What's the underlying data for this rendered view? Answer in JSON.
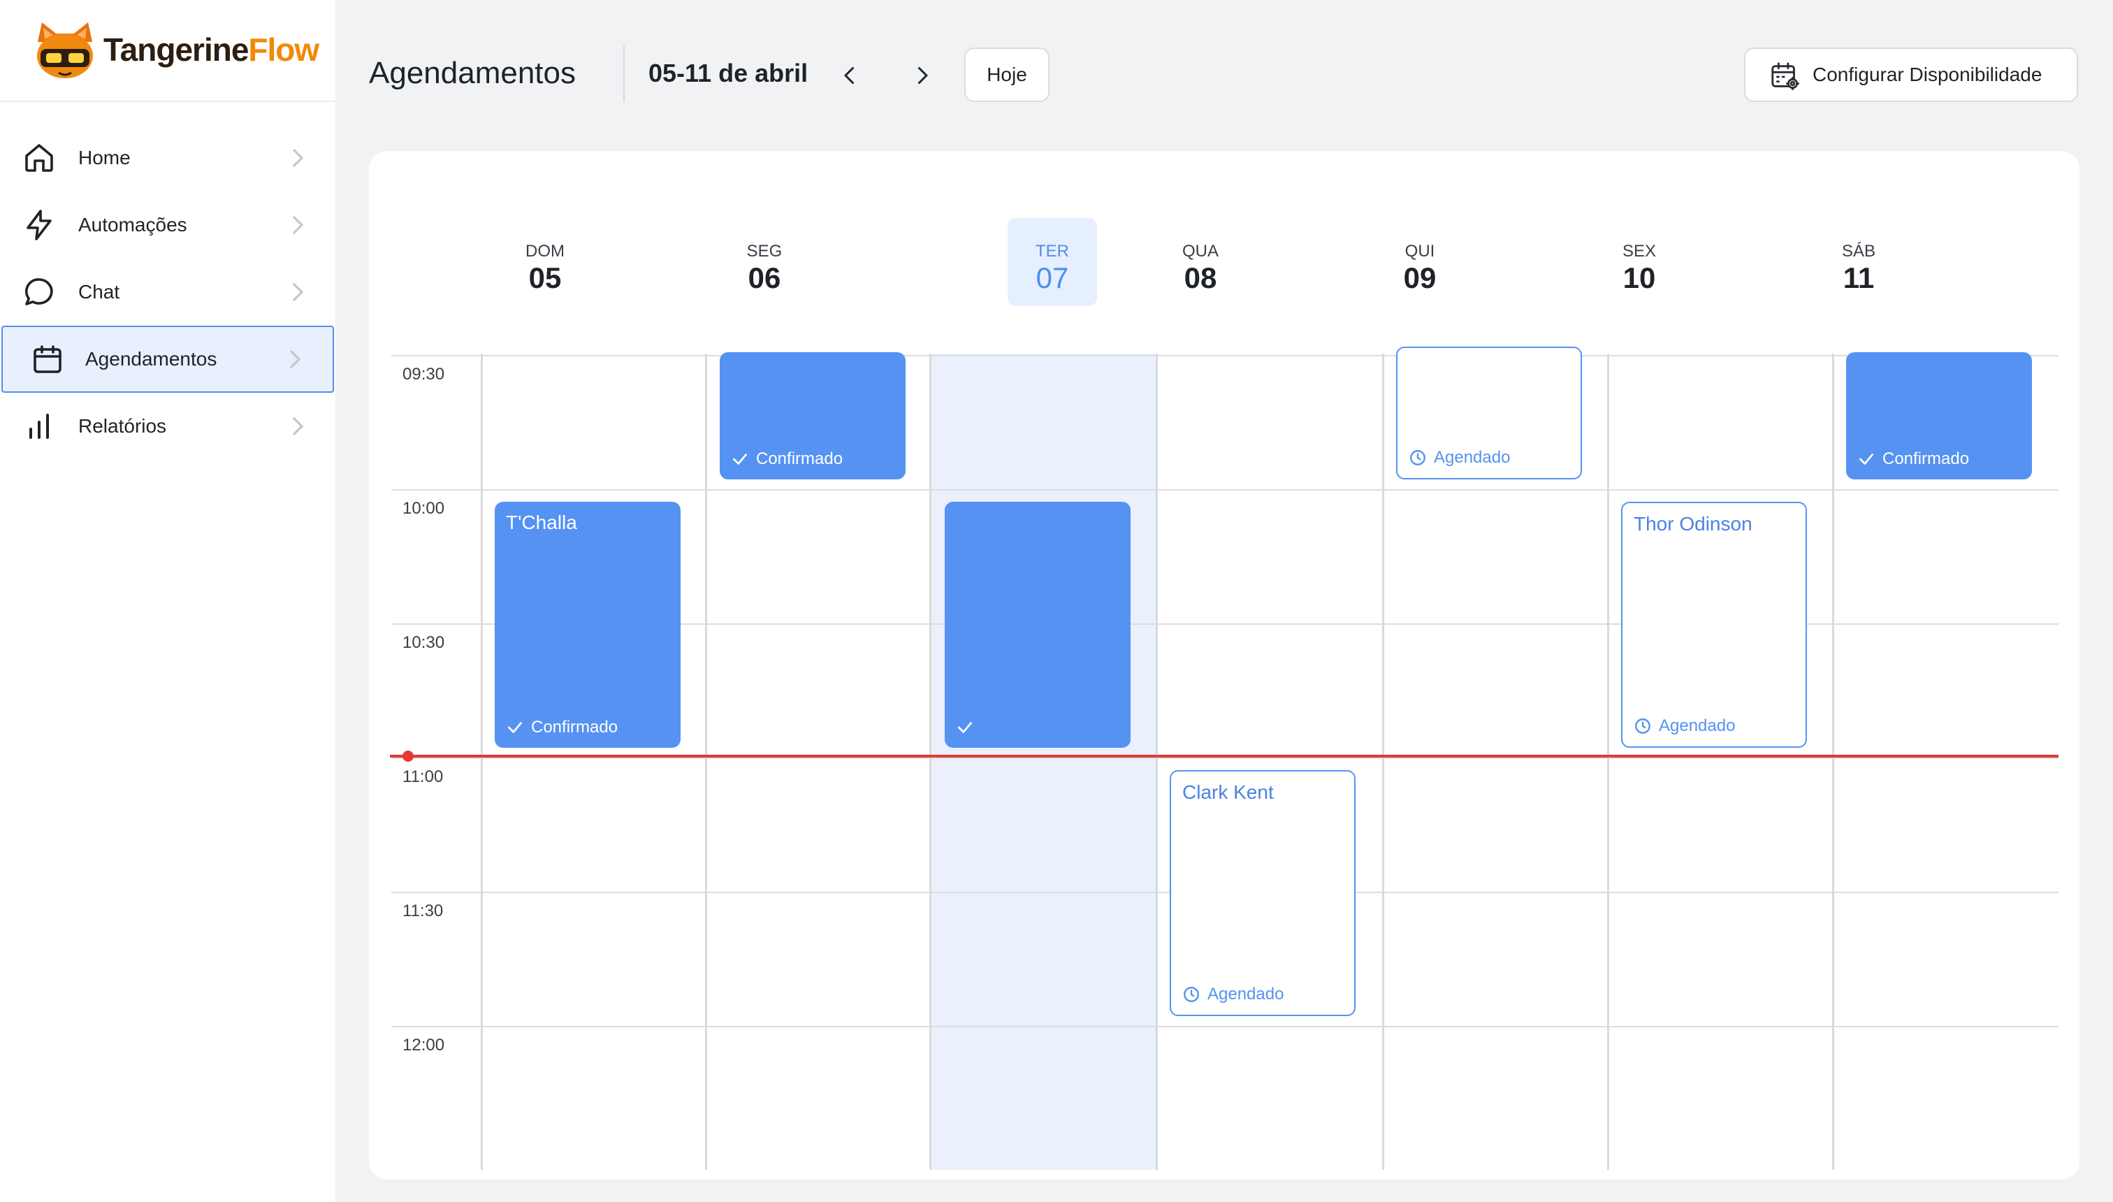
{
  "app": {
    "logo_part1": "Tangerine",
    "logo_part2": "Flow"
  },
  "sidebar": {
    "items": [
      {
        "label": "Home",
        "icon": "home-icon"
      },
      {
        "label": "Automações",
        "icon": "lightning-icon"
      },
      {
        "label": "Chat",
        "icon": "chat-bubble-icon"
      },
      {
        "label": "Agendamentos",
        "icon": "calendar-icon",
        "active": true
      },
      {
        "label": "Relatórios",
        "icon": "bar-chart-icon"
      }
    ]
  },
  "header": {
    "title": "Agendamentos",
    "date_range": "05-11 de abril",
    "today_button": "Hoje",
    "config_button": "Configurar Disponibilidade"
  },
  "calendar": {
    "days": [
      {
        "name": "DOM",
        "num": "05"
      },
      {
        "name": "SEG",
        "num": "06"
      },
      {
        "name": "TER",
        "num": "07",
        "today": true
      },
      {
        "name": "QUA",
        "num": "08"
      },
      {
        "name": "QUI",
        "num": "09"
      },
      {
        "name": "SEX",
        "num": "10"
      },
      {
        "name": "SÁB",
        "num": "11"
      }
    ],
    "times": [
      "09:30",
      "10:00",
      "10:30",
      "11:00",
      "11:30",
      "12:00"
    ],
    "events": [
      {
        "day": "SEG",
        "start": "09:00",
        "end": "09:45",
        "name": "",
        "status": "Confirmado",
        "style": "filled"
      },
      {
        "day": "QUI",
        "start": "09:00",
        "end": "09:45",
        "name": "",
        "status": "Agendado",
        "style": "outline"
      },
      {
        "day": "SÁB",
        "start": "09:00",
        "end": "09:45",
        "name": "",
        "status": "Confirmado",
        "style": "filled"
      },
      {
        "day": "DOM",
        "start": "10:00",
        "end": "10:55",
        "name": "T'Challa",
        "status": "Confirmado",
        "style": "filled"
      },
      {
        "day": "TER",
        "start": "10:00",
        "end": "10:55",
        "name": "",
        "status": "",
        "style": "filled"
      },
      {
        "day": "SEX",
        "start": "10:00",
        "end": "10:55",
        "name": "Thor Odinson",
        "status": "Agendado",
        "style": "outline"
      },
      {
        "day": "QUA",
        "start": "11:00",
        "end": "11:55",
        "name": "Clark Kent",
        "status": "Agendado",
        "style": "outline"
      }
    ],
    "current_time_indicator": "10:59"
  },
  "colors": {
    "accent": "#5592f2",
    "now_line": "#e53935",
    "today_bg": "#eaf1fc",
    "brand_orange": "#f18a07",
    "brand_dark": "#2d1e12"
  }
}
